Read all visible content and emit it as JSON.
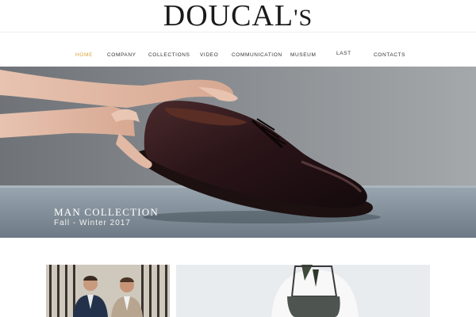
{
  "header": {
    "logo_main": "DOUCAL",
    "logo_tail": "'S"
  },
  "nav": {
    "items": [
      {
        "label": "HOME",
        "active": true
      },
      {
        "label": "COMPANY"
      },
      {
        "label": "COLLECTIONS"
      },
      {
        "label": "VIDEO"
      },
      {
        "label": "COMMUNICATION"
      },
      {
        "label": "MUSEUM"
      },
      {
        "label": "LAST NEWS"
      },
      {
        "label": "CONTACTS"
      }
    ]
  },
  "hero": {
    "title": "MAN COLLECTION",
    "subtitle": "Fall - Winter 2017"
  },
  "colors": {
    "accent": "#d9a43a",
    "text": "#333333",
    "shoe": "#2a1418"
  }
}
